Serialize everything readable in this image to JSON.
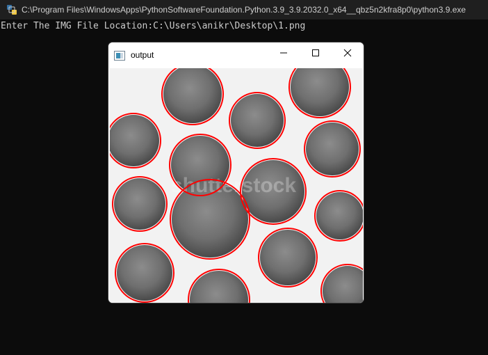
{
  "console": {
    "title": "C:\\Program Files\\WindowsApps\\PythonSoftwareFoundation.Python.3.9_3.9.2032.0_x64__qbz5n2kfra8p0\\python3.9.exe",
    "line1": "Enter The IMG File Location:C:\\Users\\anikr\\Desktop\\1.png"
  },
  "output_window": {
    "title": "output",
    "watermark": "shutterstock"
  },
  "colors": {
    "circle_outline": "#ff0000",
    "coin_fill": "#7a7a7a",
    "console_bg": "#0c0c0c"
  },
  "icons": {
    "console": "python-console-icon",
    "output": "window-app-icon",
    "minimize": "minimize-icon",
    "maximize": "maximize-icon",
    "close": "close-icon"
  }
}
